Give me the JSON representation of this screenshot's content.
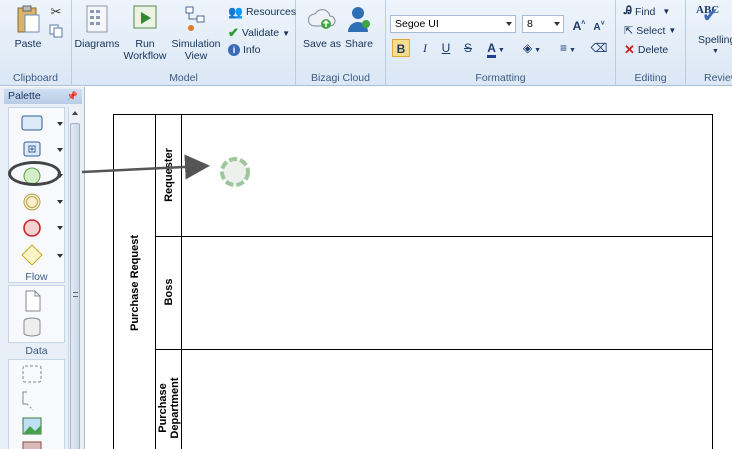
{
  "ribbon": {
    "clipboard": {
      "paste_label": "Paste",
      "group_label": "Clipboard"
    },
    "model": {
      "diagrams_label": "Diagrams",
      "run_workflow_label": "Run Workflow",
      "simulation_view_label": "Simulation View",
      "resources_label": "Resources",
      "validate_label": "Validate",
      "info_label": "Info",
      "group_label": "Model"
    },
    "cloud": {
      "save_as_label": "Save as",
      "share_label": "Share",
      "group_label": "Bizagi Cloud"
    },
    "formatting": {
      "font_family": "Segoe UI",
      "font_size": "8",
      "bold": "B",
      "italic": "I",
      "underline": "U",
      "strike": "S",
      "group_label": "Formatting"
    },
    "editing": {
      "find_label": "Find",
      "select_label": "Select",
      "delete_label": "Delete",
      "group_label": "Editing"
    },
    "review": {
      "spelling_label": "Spelling",
      "abc_text": "ABC",
      "group_label": "Review"
    }
  },
  "palette": {
    "title": "Palette",
    "flow_label": "Flow",
    "data_label": "Data"
  },
  "diagram": {
    "pool_name": "Purchase Request",
    "lanes": [
      "Requester",
      "Boss",
      "Purchase Department"
    ]
  },
  "colors": {
    "accent_active": "#fbdb8c",
    "start_event": "#86c86a",
    "end_event": "#cc2222",
    "gateway": "#e8d23a"
  }
}
